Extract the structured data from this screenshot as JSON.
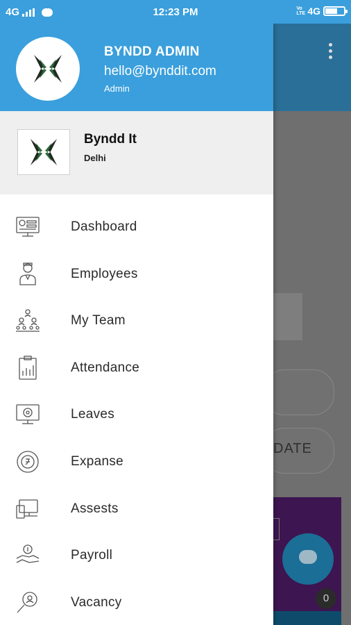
{
  "status_bar": {
    "network_left": "4G",
    "time": "12:23 PM",
    "volte": "Vo LTE",
    "network_right": "4G"
  },
  "drawer": {
    "profile": {
      "name": "BYNDD ADMIN",
      "email": "hello@bynddit.com",
      "role": "Admin"
    },
    "company": {
      "name": "Byndd It",
      "city": "Delhi"
    },
    "menu": [
      {
        "label": "Dashboard",
        "icon": "dashboard-icon"
      },
      {
        "label": "Employees",
        "icon": "employees-icon"
      },
      {
        "label": "My Team",
        "icon": "team-icon"
      },
      {
        "label": "Attendance",
        "icon": "attendance-icon"
      },
      {
        "label": "Leaves",
        "icon": "leaves-icon"
      },
      {
        "label": "Expanse",
        "icon": "expense-icon"
      },
      {
        "label": "Assests",
        "icon": "assets-icon"
      },
      {
        "label": "Payroll",
        "icon": "payroll-icon"
      },
      {
        "label": "Vacancy",
        "icon": "vacancy-icon"
      }
    ]
  },
  "background": {
    "button_partial": "DATE",
    "chat_badge": "0"
  },
  "colors": {
    "header_blue": "#3a9fdc",
    "logo_dark": "#1f2a22",
    "logo_green": "#2f6a3a"
  }
}
